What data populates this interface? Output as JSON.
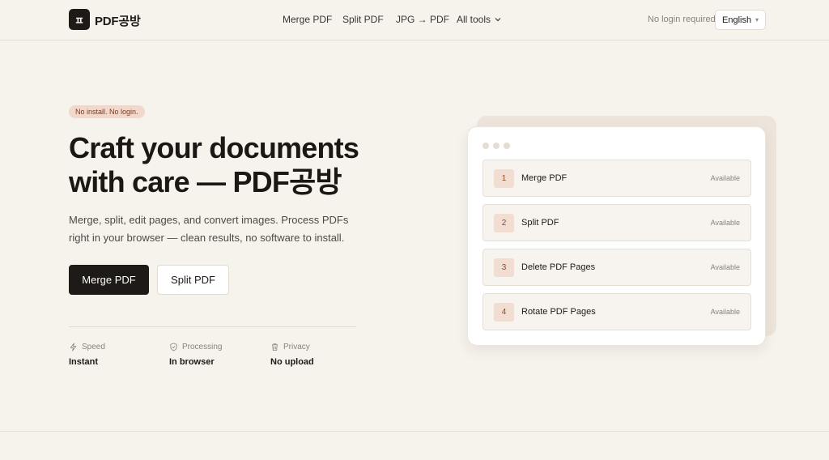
{
  "header": {
    "logo_mark": "ㅍ",
    "logo_text": "PDF공방",
    "nav": {
      "merge": "Merge PDF",
      "split": "Split PDF",
      "jpg": "JPG → PDF",
      "all_tools": "All tools"
    },
    "no_login": "No login required",
    "language": "English"
  },
  "hero": {
    "badge": "No install. No login.",
    "title_line1": "Craft your documents",
    "title_line2": "with care — PDF공방",
    "description": "Merge, split, edit pages, and convert images. Process PDFs right in your browser — clean results, no software to install.",
    "primary_button": "Merge PDF",
    "secondary_button": "Split PDF"
  },
  "stats": [
    {
      "label": "Speed",
      "value": "Instant",
      "icon": "lightning-icon"
    },
    {
      "label": "Processing",
      "value": "In browser",
      "icon": "shield-icon"
    },
    {
      "label": "Privacy",
      "value": "No upload",
      "icon": "trash-icon"
    }
  ],
  "tools": [
    {
      "num": "1",
      "name": "Merge PDF",
      "status": "Available"
    },
    {
      "num": "2",
      "name": "Split PDF",
      "status": "Available"
    },
    {
      "num": "3",
      "name": "Delete PDF Pages",
      "status": "Available"
    },
    {
      "num": "4",
      "name": "Rotate PDF Pages",
      "status": "Available"
    }
  ],
  "colors": {
    "background": "#f6f2ec",
    "primary": "#1d1a17",
    "badge_bg": "#f0d8cc",
    "accent": "#8a4a2c"
  }
}
